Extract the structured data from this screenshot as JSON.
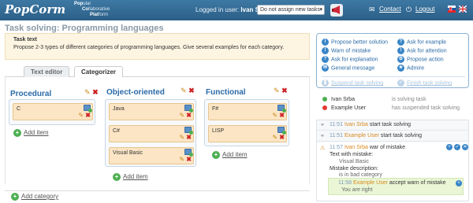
{
  "header": {
    "logo": "PopCorm",
    "tagline": [
      {
        "bold": "Pop",
        "rest": "ular"
      },
      {
        "bold": "Co",
        "rest": "llaborative"
      },
      {
        "bold": "Plat",
        "rest": "form"
      }
    ],
    "logged_prefix": "Logged in user:",
    "logged_user": "Ivan Srba",
    "assign_select": "Do not assign new tasks",
    "contact": "Contact",
    "logout": "Logout"
  },
  "page": {
    "title": "Task solving: Programming languages",
    "task_heading": "Task text",
    "task_text": "Propose 2-3 types of different categories of programming languages. Give several examples for each category."
  },
  "tabs": [
    {
      "label": "Text editor",
      "active": false
    },
    {
      "label": "Categorizer",
      "active": true
    }
  ],
  "categories": [
    {
      "name": "Procedural",
      "items": [
        "C"
      ]
    },
    {
      "name": "Object-oriented",
      "items": [
        "Java",
        "C#",
        "Visual Basic"
      ]
    },
    {
      "name": "Functional",
      "items": [
        "F#",
        "LISP"
      ]
    }
  ],
  "labels": {
    "add_item": "Add item",
    "add_category": "Add category"
  },
  "actions": {
    "left": [
      "Propose better solution",
      "Warn of mistake",
      "Ask for explanation",
      "General message"
    ],
    "right": [
      "Ask for example",
      "Ask for attention",
      "Propose action",
      "Admire"
    ],
    "suspend": "Suspend task solving",
    "finish": "Finish task solving"
  },
  "users": [
    {
      "name": "Ivan Srba",
      "status": "is solving task",
      "color": "#4caf50"
    },
    {
      "name": "Example User",
      "status": "has suspended task solving",
      "color": "#e53935"
    }
  ],
  "log": {
    "entries": [
      {
        "time": "11:51",
        "user": "Ivan Srba",
        "text": "start task solving"
      },
      {
        "time": "11:51",
        "user": "Example User",
        "text": "start task solving"
      }
    ],
    "warn": {
      "time": "11:57",
      "user": "Ivan Srba",
      "text": "war of mistake",
      "l1": "Text with mistake:",
      "l2": "Visual Basic",
      "l3": "Mistake description:",
      "l4": "is in bad category"
    },
    "reply": {
      "time": "11:58",
      "user": "Example User",
      "text": "accept warn of mistake",
      "l1": "You are right"
    }
  }
}
